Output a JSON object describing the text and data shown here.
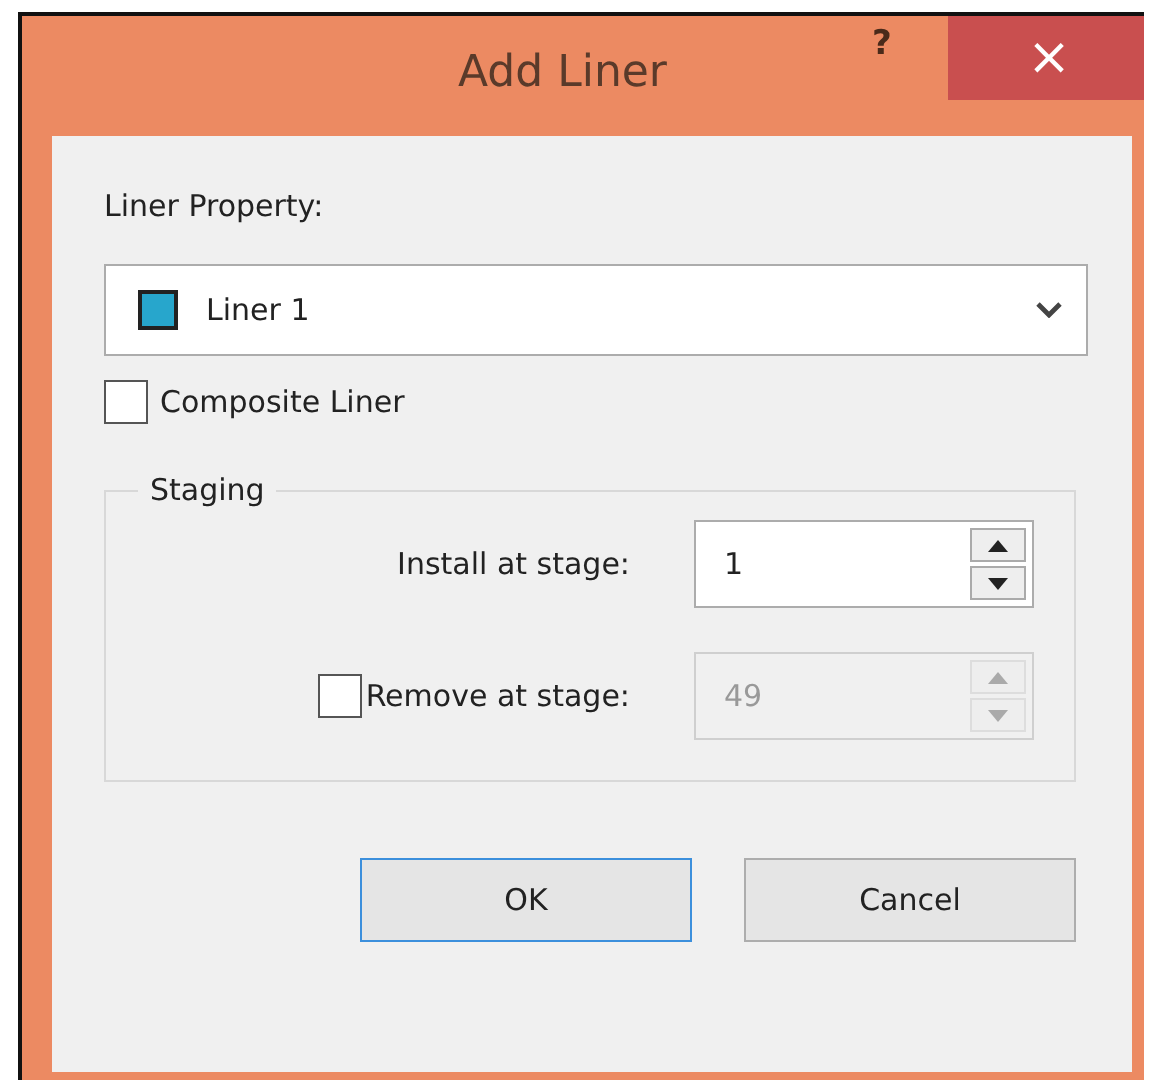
{
  "window": {
    "title": "Add Liner",
    "help": "?",
    "close": "×"
  },
  "liner_property": {
    "label": "Liner Property:",
    "value": "Liner 1",
    "color": "#27a6cc"
  },
  "composite_liner": {
    "label": "Composite Liner",
    "checked": false
  },
  "staging": {
    "title": "Staging",
    "install": {
      "label": "Install at stage:",
      "value": "1",
      "disabled": false
    },
    "remove": {
      "label": "Remove at stage:",
      "value": "49",
      "checked": false,
      "disabled": true
    }
  },
  "buttons": [
    {
      "label": "OK",
      "default": true
    },
    {
      "label": "Cancel",
      "default": false
    }
  ]
}
